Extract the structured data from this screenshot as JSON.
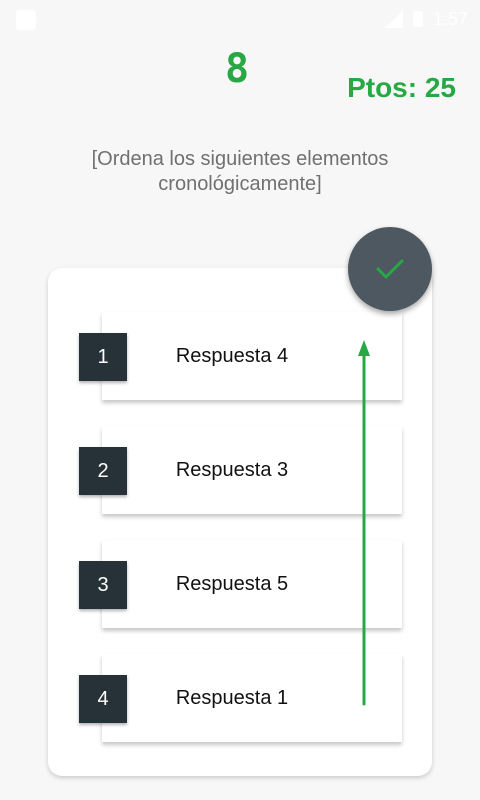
{
  "status_bar": {
    "time": "1:57"
  },
  "game": {
    "timer": "8",
    "score": "Ptos: 25",
    "instruction": "[Ordena los siguientes elementos cronológicamente]"
  },
  "answers": [
    {
      "number": "1",
      "label": "Respuesta 4"
    },
    {
      "number": "2",
      "label": "Respuesta 3"
    },
    {
      "number": "3",
      "label": "Respuesta 5"
    },
    {
      "number": "4",
      "label": "Respuesta 1"
    }
  ],
  "colors": {
    "accent": "#28a745",
    "badge": "#263238",
    "fab": "#4d5860"
  },
  "icons": {
    "fab": "check-icon",
    "annotation": "drag-arrow-up"
  }
}
